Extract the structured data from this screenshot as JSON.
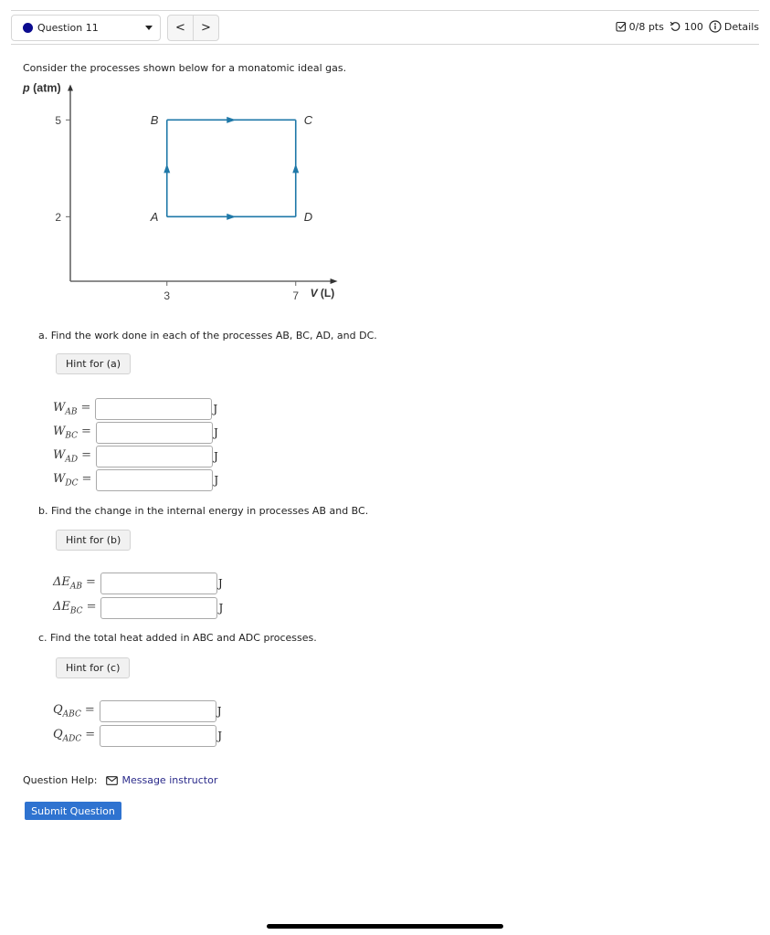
{
  "header": {
    "question_selector": "Question 11",
    "prev_label": "<",
    "next_label": ">",
    "points": "0/8 pts",
    "attempts": "100",
    "details_label": "Details",
    "status_dot_color": "#0b0b8f"
  },
  "intro": "Consider the processes shown below for a monatomic ideal gas.",
  "chart_data": {
    "type": "line",
    "title": "",
    "xlabel": "V (L)",
    "ylabel": "p (atm)",
    "x_ticks": [
      "3",
      "7"
    ],
    "y_ticks": [
      "5",
      "2"
    ],
    "xlim": [
      0,
      8.3
    ],
    "ylim": [
      0,
      6.1
    ],
    "points": [
      {
        "label": "A",
        "x": 3,
        "y": 2
      },
      {
        "label": "B",
        "x": 3,
        "y": 5
      },
      {
        "label": "C",
        "x": 7,
        "y": 5
      },
      {
        "label": "D",
        "x": 7,
        "y": 2
      }
    ],
    "paths": [
      {
        "name": "A→B",
        "from": "A",
        "to": "B"
      },
      {
        "name": "B→C",
        "from": "B",
        "to": "C"
      },
      {
        "name": "A→D",
        "from": "A",
        "to": "D"
      },
      {
        "name": "D→C",
        "from": "D",
        "to": "C"
      }
    ],
    "line_color": "#1f78a8",
    "grid": false
  },
  "parts": {
    "a": {
      "text": "a.  Find the work done in each of the processes AB, BC, AD, and DC.",
      "hint": "Hint for (a)",
      "fields": [
        {
          "symbol": "W",
          "sub": "AB",
          "value": "",
          "unit": "J"
        },
        {
          "symbol": "W",
          "sub": "BC",
          "value": "",
          "unit": "J"
        },
        {
          "symbol": "W",
          "sub": "AD",
          "value": "",
          "unit": "J"
        },
        {
          "symbol": "W",
          "sub": "DC",
          "value": "",
          "unit": "J"
        }
      ]
    },
    "b": {
      "text": "b.  Find the change in the internal energy in processes AB and BC.",
      "hint": "Hint for (b)",
      "fields": [
        {
          "symbol": "ΔE",
          "sub": "AB",
          "value": "",
          "unit": "J"
        },
        {
          "symbol": "ΔE",
          "sub": "BC",
          "value": "",
          "unit": "J"
        }
      ]
    },
    "c": {
      "text": "c.  Find the total heat added in ABC and ADC processes.",
      "hint": "Hint for (c)",
      "fields": [
        {
          "symbol": "Q",
          "sub": "ABC",
          "value": "",
          "unit": "J"
        },
        {
          "symbol": "Q",
          "sub": "ADC",
          "value": "",
          "unit": "J"
        }
      ]
    }
  },
  "equals": "=",
  "help": {
    "label": "Question Help:",
    "link": "Message instructor"
  },
  "submit_label": "Submit Question"
}
